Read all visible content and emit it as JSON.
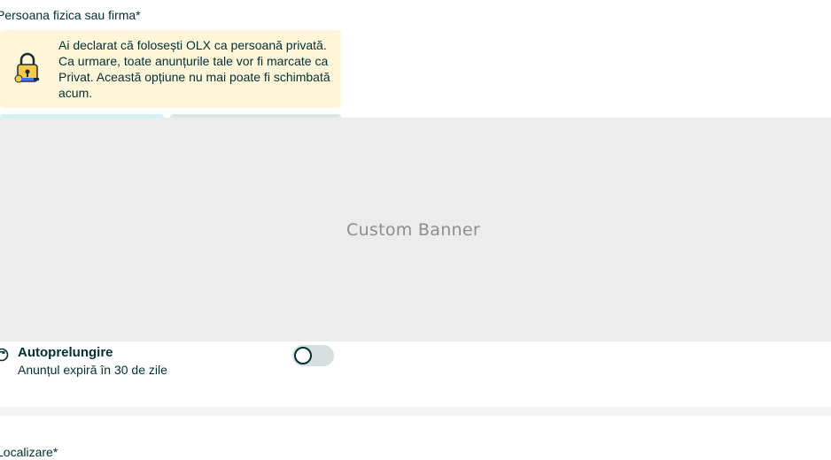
{
  "form": {
    "person_type_label": "Persoana fizica sau firma*",
    "location_label": "Localizare*"
  },
  "notice": {
    "icon": "lock-icon",
    "text": "Ai declarat că folosești OLX ca persoană privată. Ca urmare, toate anunțurile tale vor fi marcate ca Privat. Această opțiune nu mai poate fi schimbată acum."
  },
  "banner": {
    "text": "Custom Banner"
  },
  "autorenew": {
    "icon": "autorenew-icon",
    "title": "Autoprelungire",
    "subtitle": "Anunțul expiră în 30 de zile",
    "enabled": false
  },
  "colors": {
    "notice_bg": "#fff6d9",
    "banner_bg": "#ececec",
    "text": "#002f34",
    "toggle_track": "#d8dfe0",
    "segment_active": "#cdf5f3"
  }
}
